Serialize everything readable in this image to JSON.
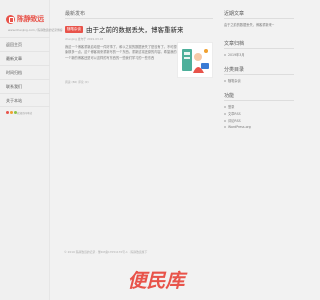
{
  "brand": {
    "logo_text": "陈静致远",
    "logo_url": "www.Chenjing.com / 陈静致远的记录博客"
  },
  "sidebar": {
    "items": [
      {
        "label": "返回主页"
      },
      {
        "label": "最新文章"
      },
      {
        "label": "时间归档"
      },
      {
        "label": "联系我们"
      },
      {
        "label": "关于本站"
      }
    ],
    "mini_label": "欢迎访问本站"
  },
  "main": {
    "section_title": "最新发布",
    "post": {
      "badge": "随笔杂谈",
      "title": "由于之前的数据丢失，博客重新来~",
      "meta": "chenjing 发布于 2019-03-03",
      "excerpt": "我这一个博客重新启动是一件好事了，和以之前的数据丢失了是没有了。不可想象那多一点。这个博客用来重新写的一个东西。重新这将还原的内容。希望我的一个新的博客还是可以这样的写东西的一些我们学习的一些东西",
      "foot": "阅读 (86) 评论 (0)"
    }
  },
  "right": {
    "recent_title": "近期文章",
    "recent_items": [
      "由于之前的数据丢失，博客重新来~"
    ],
    "archive_title": "文章归档",
    "archive_items": [
      "2019年3月"
    ],
    "category_title": "分类目录",
    "category_items": [
      "随笔杂谈"
    ],
    "meta_title": "功能",
    "meta_items": [
      "登录",
      "文章RSS",
      "评论RSS",
      "WordPress.org"
    ]
  },
  "footer": {
    "text": "© 2019 陈静致远的记录 · 豫ICP备17051170号-1 · 陈静致远旗下"
  },
  "watermark": {
    "text": "便民库"
  },
  "colors": {
    "accent": "#e8534a",
    "background": "#f2f2f2"
  }
}
